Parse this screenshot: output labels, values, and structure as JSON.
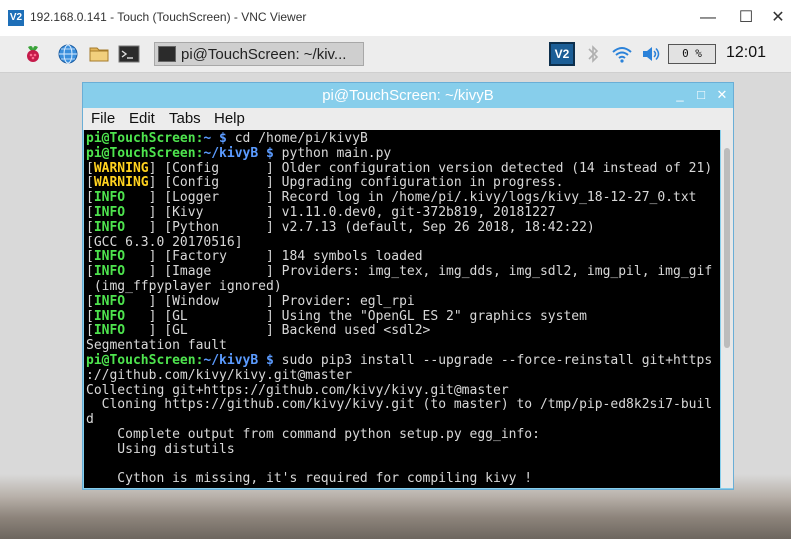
{
  "vnc": {
    "logo": "V2",
    "title": "192.168.0.141 - Touch (TouchScreen) - VNC Viewer",
    "minimize": "—",
    "maximize": "☐",
    "close": "✕"
  },
  "taskbar": {
    "task_label": "pi@TouchScreen: ~/kiv...",
    "tray_logo": "V2",
    "cpu": "0 %",
    "clock": "12:01",
    "icons": [
      "raspberry-menu-icon",
      "web-browser-icon",
      "file-manager-icon",
      "terminal-icon",
      "bluetooth-icon",
      "wifi-icon",
      "volume-icon"
    ]
  },
  "terminal": {
    "title": "pi@TouchScreen: ~/kivyB",
    "minimize": "_",
    "maximize": "□",
    "close": "✕",
    "menu": [
      "File",
      "Edit",
      "Tabs",
      "Help"
    ],
    "lines": [
      {
        "prompt": "pi@TouchScreen:",
        "path": "~ $",
        "rest": " cd /home/pi/kivyB"
      },
      {
        "prompt": "pi@TouchScreen:",
        "path": "~/kivyB $",
        "rest": " python main.py"
      },
      {
        "pre": "[",
        "tag": "WARNING",
        "tagtype": "warn",
        "rest": "] [Config      ] Older configuration version detected (14 instead of 21)"
      },
      {
        "pre": "[",
        "tag": "WARNING",
        "tagtype": "warn",
        "rest": "] [Config      ] Upgrading configuration in progress."
      },
      {
        "pre": "[",
        "tag": "INFO   ",
        "tagtype": "info",
        "rest": "] [Logger      ] Record log in /home/pi/.kivy/logs/kivy_18-12-27_0.txt"
      },
      {
        "pre": "[",
        "tag": "INFO   ",
        "tagtype": "info",
        "rest": "] [Kivy        ] v1.11.0.dev0, git-372b819, 20181227"
      },
      {
        "pre": "[",
        "tag": "INFO   ",
        "tagtype": "info",
        "rest": "] [Python      ] v2.7.13 (default, Sep 26 2018, 18:42:22)"
      },
      {
        "text": "[GCC 6.3.0 20170516]"
      },
      {
        "pre": "[",
        "tag": "INFO   ",
        "tagtype": "info",
        "rest": "] [Factory     ] 184 symbols loaded"
      },
      {
        "pre": "[",
        "tag": "INFO   ",
        "tagtype": "info",
        "rest": "] [Image       ] Providers: img_tex, img_dds, img_sdl2, img_pil, img_gif"
      },
      {
        "text": " (img_ffpyplayer ignored)"
      },
      {
        "pre": "[",
        "tag": "INFO   ",
        "tagtype": "info",
        "rest": "] [Window      ] Provider: egl_rpi"
      },
      {
        "pre": "[",
        "tag": "INFO   ",
        "tagtype": "info",
        "rest": "] [GL          ] Using the \"OpenGL ES 2\" graphics system"
      },
      {
        "pre": "[",
        "tag": "INFO   ",
        "tagtype": "info",
        "rest": "] [GL          ] Backend used <sdl2>"
      },
      {
        "text": "Segmentation fault"
      },
      {
        "prompt": "pi@TouchScreen:",
        "path": "~/kivyB $",
        "rest": " sudo pip3 install --upgrade --force-reinstall git+https"
      },
      {
        "text": "://github.com/kivy/kivy.git@master"
      },
      {
        "text": "Collecting git+https://github.com/kivy/kivy.git@master"
      },
      {
        "text": "  Cloning https://github.com/kivy/kivy.git (to master) to /tmp/pip-ed8k2si7-buil"
      },
      {
        "text": "d"
      },
      {
        "text": "    Complete output from command python setup.py egg_info:"
      },
      {
        "text": "    Using distutils"
      },
      {
        "text": ""
      },
      {
        "text": "    Cython is missing, it's required for compiling kivy !"
      }
    ]
  }
}
